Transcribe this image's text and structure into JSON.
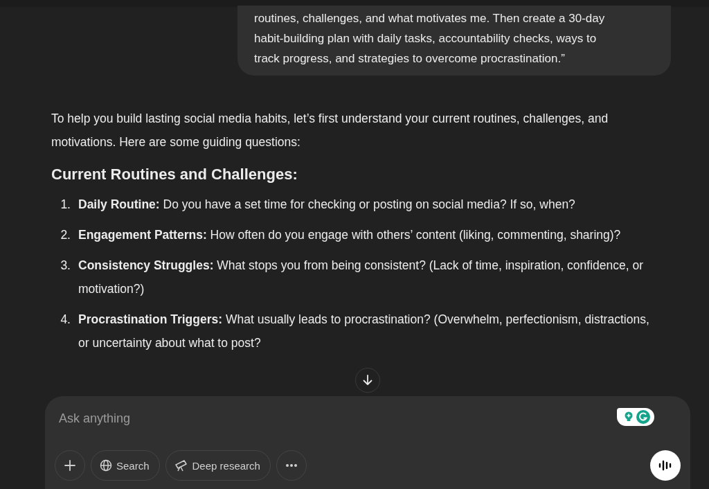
{
  "user_message": {
    "lines": [
      "routines, challenges, and what motivates me. Then create a 30-day",
      "habit-building plan with daily tasks, accountability checks, ways to",
      "track progress, and strategies to overcome procrastination.”"
    ]
  },
  "response": {
    "intro": "To help you build lasting social media habits, let’s first understand your current routines, challenges, and motivations. Here are some guiding questions:",
    "heading": "Current Routines and Challenges:",
    "items": [
      {
        "number": "1.",
        "label": "Daily Routine:",
        "text": "Do you have a set time for checking or posting on social media? If so, when?"
      },
      {
        "number": "2.",
        "label": "Engagement Patterns:",
        "text": "How often do you engage with others’ content (liking, commenting, sharing)?"
      },
      {
        "number": "3.",
        "label": "Consistency Struggles:",
        "text": "What stops you from being consistent? (Lack of time, inspiration, confidence, or motivation?)"
      },
      {
        "number": "4.",
        "label": "Procrastination Triggers:",
        "text": "What usually leads to procrastination? (Overwhelm, perfectionism, distractions, or uncertainty about what to post?"
      }
    ]
  },
  "composer": {
    "placeholder": "Ask anything",
    "tools": [
      {
        "kind": "plus"
      },
      {
        "kind": "search",
        "label": "Search"
      },
      {
        "kind": "research",
        "label": "Deep research"
      },
      {
        "kind": "more"
      }
    ]
  }
}
